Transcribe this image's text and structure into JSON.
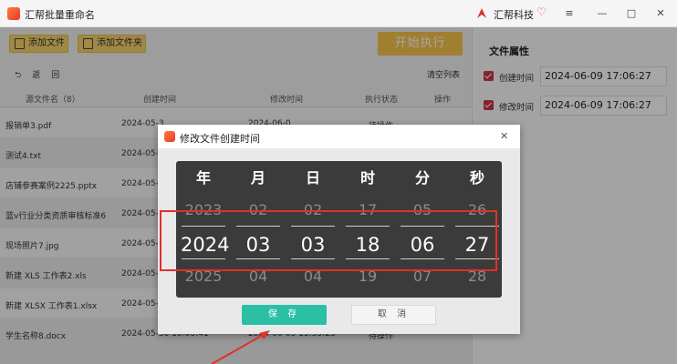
{
  "app": {
    "title": "汇帮批量重命名",
    "brand": "汇帮科技",
    "window_controls": [
      "≡",
      "—",
      "□",
      "✕"
    ]
  },
  "toolbar": {
    "add_file": "添加文件",
    "add_folder": "添加文件夹",
    "start": "开始执行"
  },
  "nav": {
    "back": "返",
    "back_suffix": "回",
    "clear_list": "清空列表"
  },
  "table": {
    "headers": [
      "源文件名（8）",
      "创建时间",
      "修改时间",
      "执行状态",
      "操作"
    ],
    "rows": [
      {
        "name": "报销单3.pdf",
        "created": "2024-05-3",
        "modified": "2024-06-0",
        "status": "待操作"
      },
      {
        "name": "测试4.txt",
        "created": "2024-05-",
        "modified": "",
        "status": ""
      },
      {
        "name": "店铺参赛案例2225.pptx",
        "created": "2024-05-",
        "modified": "",
        "status": ""
      },
      {
        "name": "蓝v行业分类资质审核标准6",
        "created": "2024-05-",
        "modified": "",
        "status": ""
      },
      {
        "name": "现场照片7.jpg",
        "created": "2024-05-",
        "modified": "",
        "status": ""
      },
      {
        "name": "新建 XLS 工作表2.xls",
        "created": "2024-05-",
        "modified": "",
        "status": ""
      },
      {
        "name": "新建 XLSX 工作表1.xlsx",
        "created": "2024-05-",
        "modified": "",
        "status": ""
      },
      {
        "name": "学生名称8.docx",
        "created": "2024-05-30 10:00:41",
        "modified": "2024-06-09 15:55:23",
        "status": "待操作"
      }
    ]
  },
  "properties": {
    "title": "文件属性",
    "created_label": "创建时间",
    "created_value": "2024-06-09 17:06:27",
    "modified_label": "修改时间",
    "modified_value": "2024-06-09 17:06:27"
  },
  "dialog": {
    "title": "修改文件创建时间",
    "close": "✕",
    "columns": [
      {
        "head": "年",
        "prev": "2023",
        "current": "2024",
        "next": "2025"
      },
      {
        "head": "月",
        "prev": "02",
        "current": "03",
        "next": "04"
      },
      {
        "head": "日",
        "prev": "02",
        "current": "03",
        "next": "04"
      },
      {
        "head": "时",
        "prev": "17",
        "current": "18",
        "next": "19"
      },
      {
        "head": "分",
        "prev": "05",
        "current": "06",
        "next": "07"
      },
      {
        "head": "秒",
        "prev": "26",
        "current": "27",
        "next": "28"
      }
    ],
    "save": "保 存",
    "cancel": "取 消"
  },
  "colors": {
    "accent_yellow": "#f6c54b",
    "save_green": "#2bbfa6",
    "annotation_red": "#e0312a",
    "check_red": "#c9364a"
  }
}
